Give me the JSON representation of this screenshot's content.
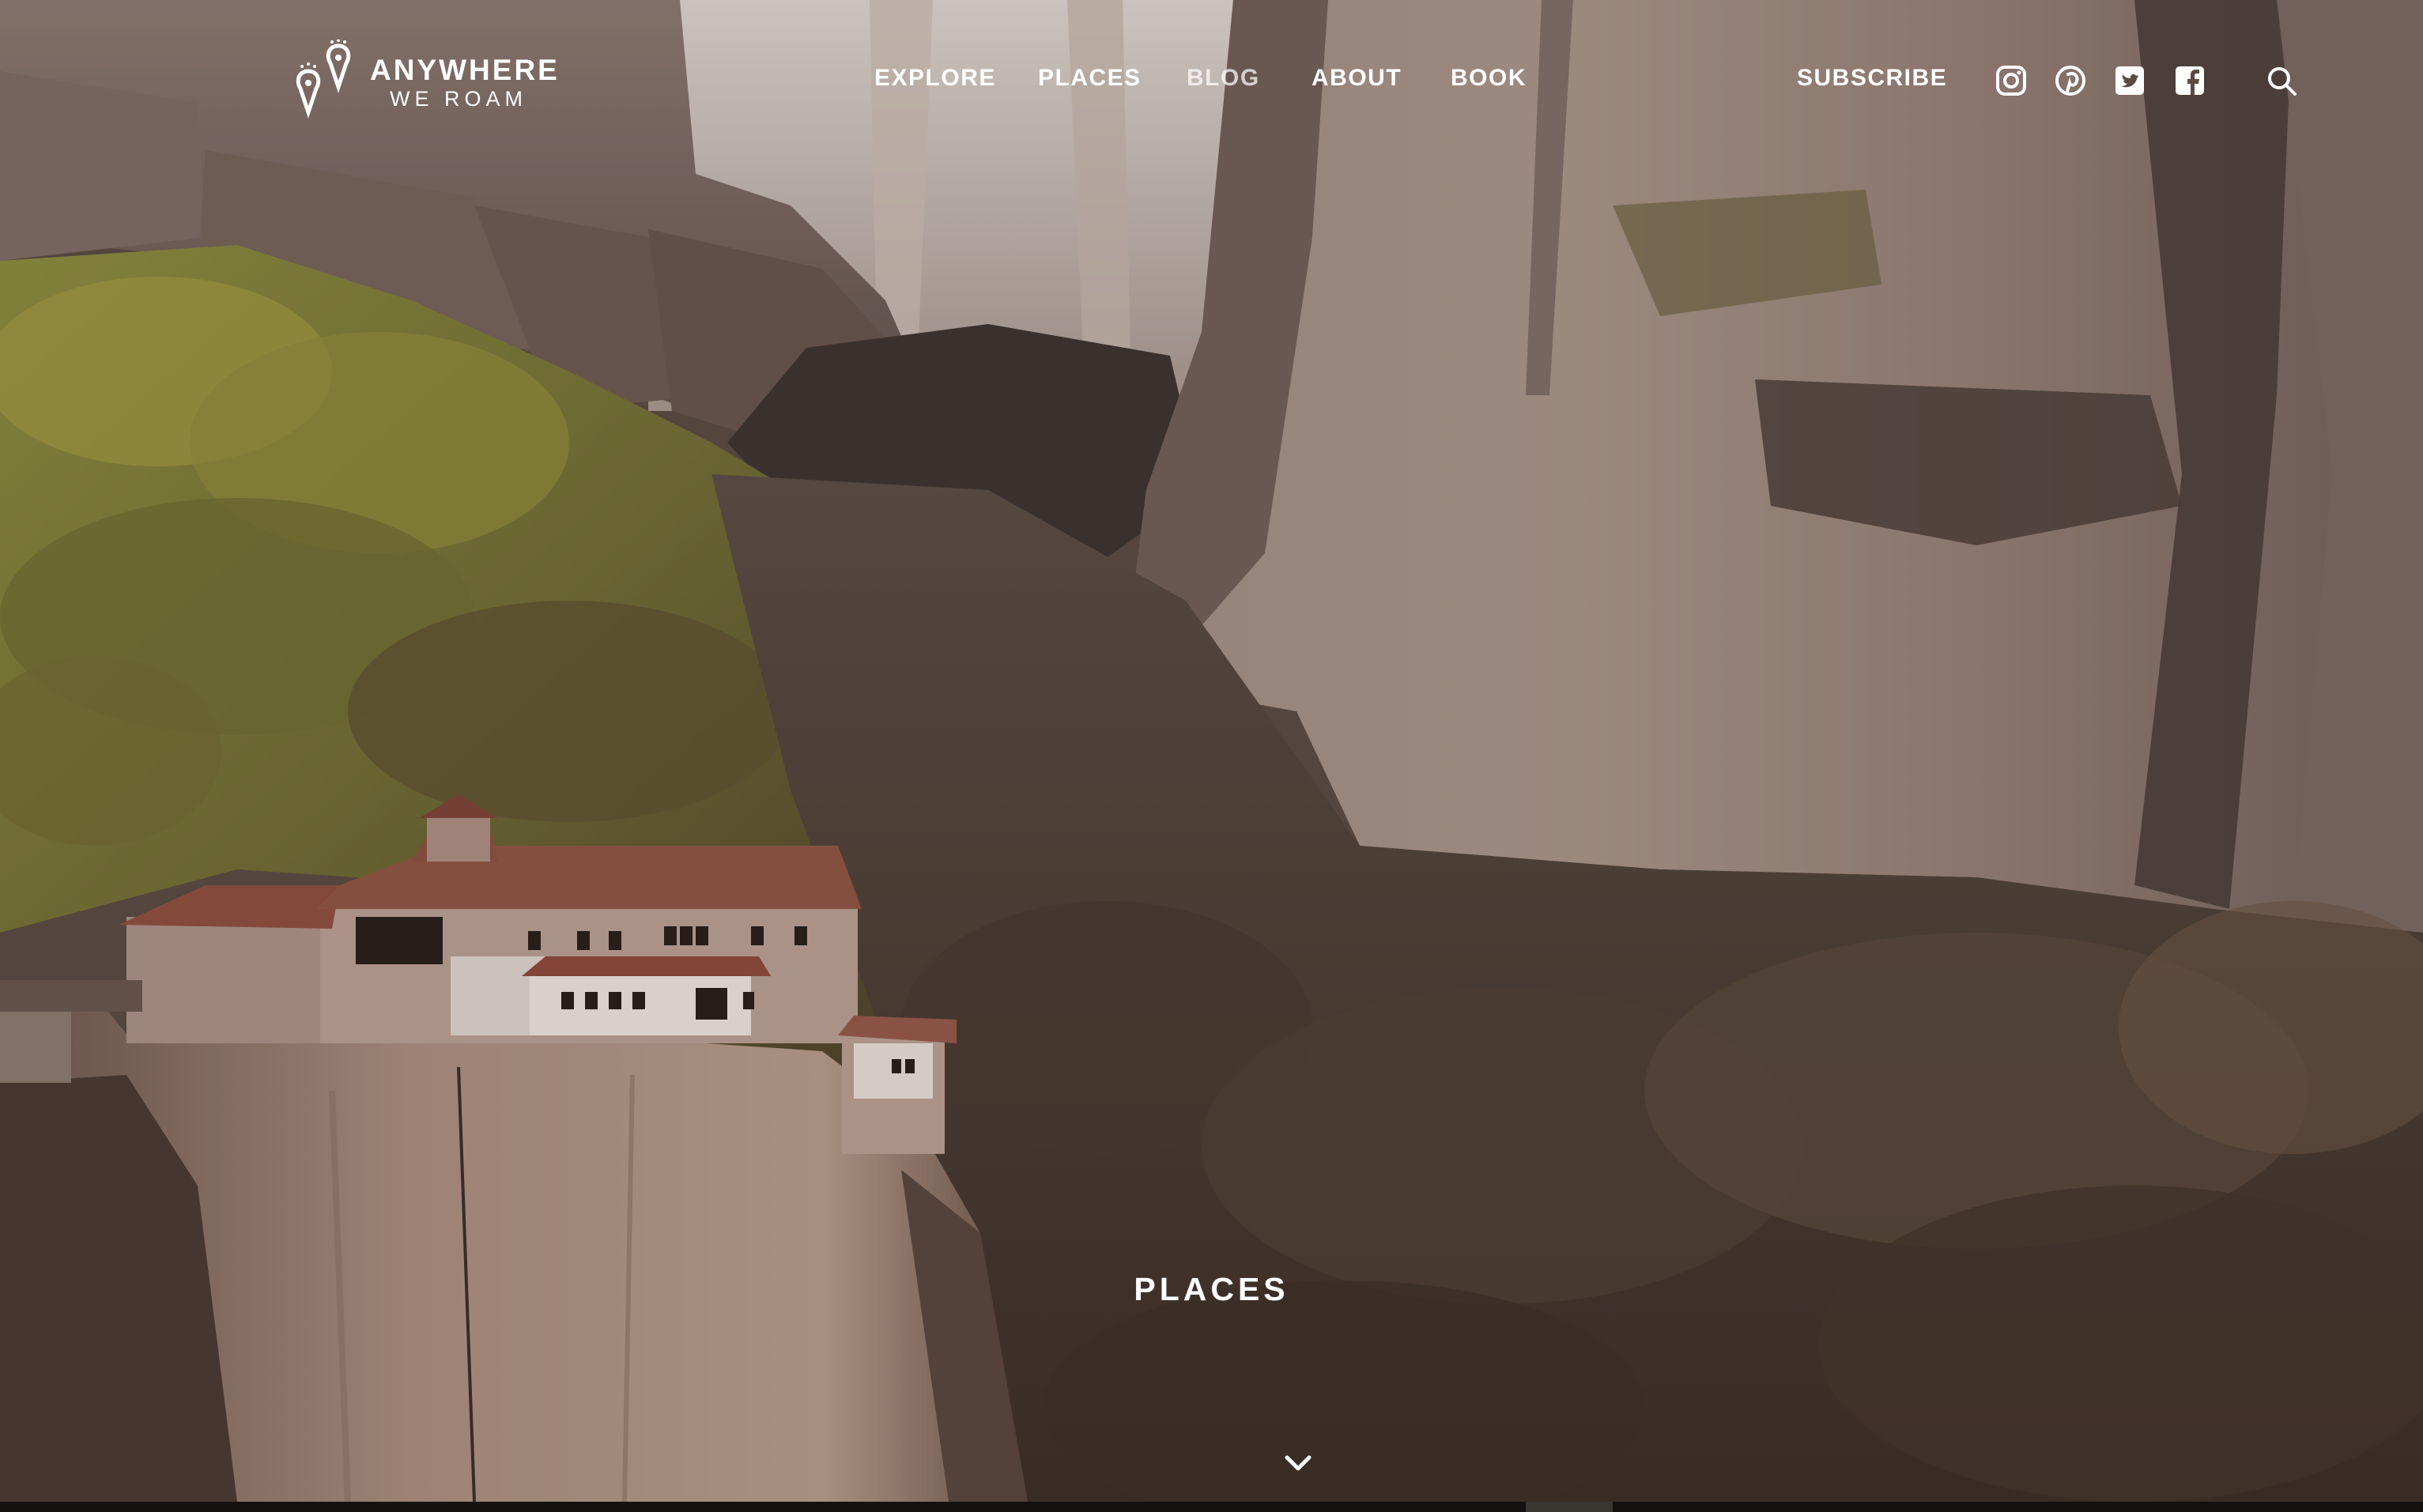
{
  "logo": {
    "brand": "ANYWHERE",
    "tagline": "WE ROAM"
  },
  "nav": {
    "items": [
      {
        "label": "EXPLORE"
      },
      {
        "label": "PLACES"
      },
      {
        "label": "BLOG"
      },
      {
        "label": "ABOUT"
      },
      {
        "label": "BOOK"
      }
    ],
    "subscribe_label": "SUBSCRIBE"
  },
  "social": {
    "icons": [
      "instagram-icon",
      "pinterest-icon",
      "twitter-icon",
      "facebook-icon"
    ]
  },
  "search": {
    "icon": "search-icon"
  },
  "hero": {
    "title": "PLACES",
    "scroll_icon": "chevron-down-icon"
  },
  "colors": {
    "text": "#ffffff",
    "forest_light": "#8a8a3a",
    "forest_dark": "#4a3a2f",
    "rock": "#9a857a",
    "roof": "#8a4a3a"
  }
}
